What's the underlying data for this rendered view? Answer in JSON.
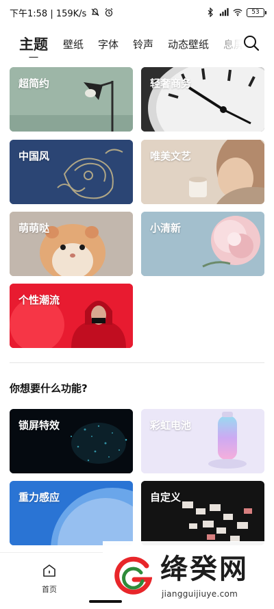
{
  "status_bar": {
    "time_speed": "下午1:58 | 159K/s",
    "battery": "53",
    "icons": [
      "alarm-off-icon",
      "alarm-icon",
      "bluetooth-icon",
      "signal-icon",
      "wifi-icon",
      "battery-icon"
    ]
  },
  "tabs": [
    {
      "label": "主题",
      "active": true
    },
    {
      "label": "壁纸"
    },
    {
      "label": "字体"
    },
    {
      "label": "铃声"
    },
    {
      "label": "动态壁纸"
    },
    {
      "label": "息屏"
    }
  ],
  "theme_cards": [
    {
      "label": "超简约",
      "color": "#9cb5a6"
    },
    {
      "label": "轻奢商务",
      "color": "#3b3b3b"
    },
    {
      "label": "中国风",
      "color": "#2d4a7a"
    },
    {
      "label": "唯美文艺",
      "color": "#d8c4b2"
    },
    {
      "label": "萌萌哒",
      "color": "#b59879"
    },
    {
      "label": "小清新",
      "color": "#9ab7c6"
    },
    {
      "label": "个性潮流",
      "color": "#d4122a"
    }
  ],
  "section_title": "你想要什么功能?",
  "feature_cards": [
    {
      "label": "锁屏特效",
      "color": "#061018"
    },
    {
      "label": "彩虹电池",
      "color": "#e6e2f7"
    },
    {
      "label": "重力感应",
      "color": "#2f7bd8"
    },
    {
      "label": "自定义",
      "color": "#121212"
    }
  ],
  "bottom_nav": {
    "home_label": "首页"
  },
  "watermark": {
    "title": "绛癸网",
    "url": "jiangguijiuye.com"
  }
}
